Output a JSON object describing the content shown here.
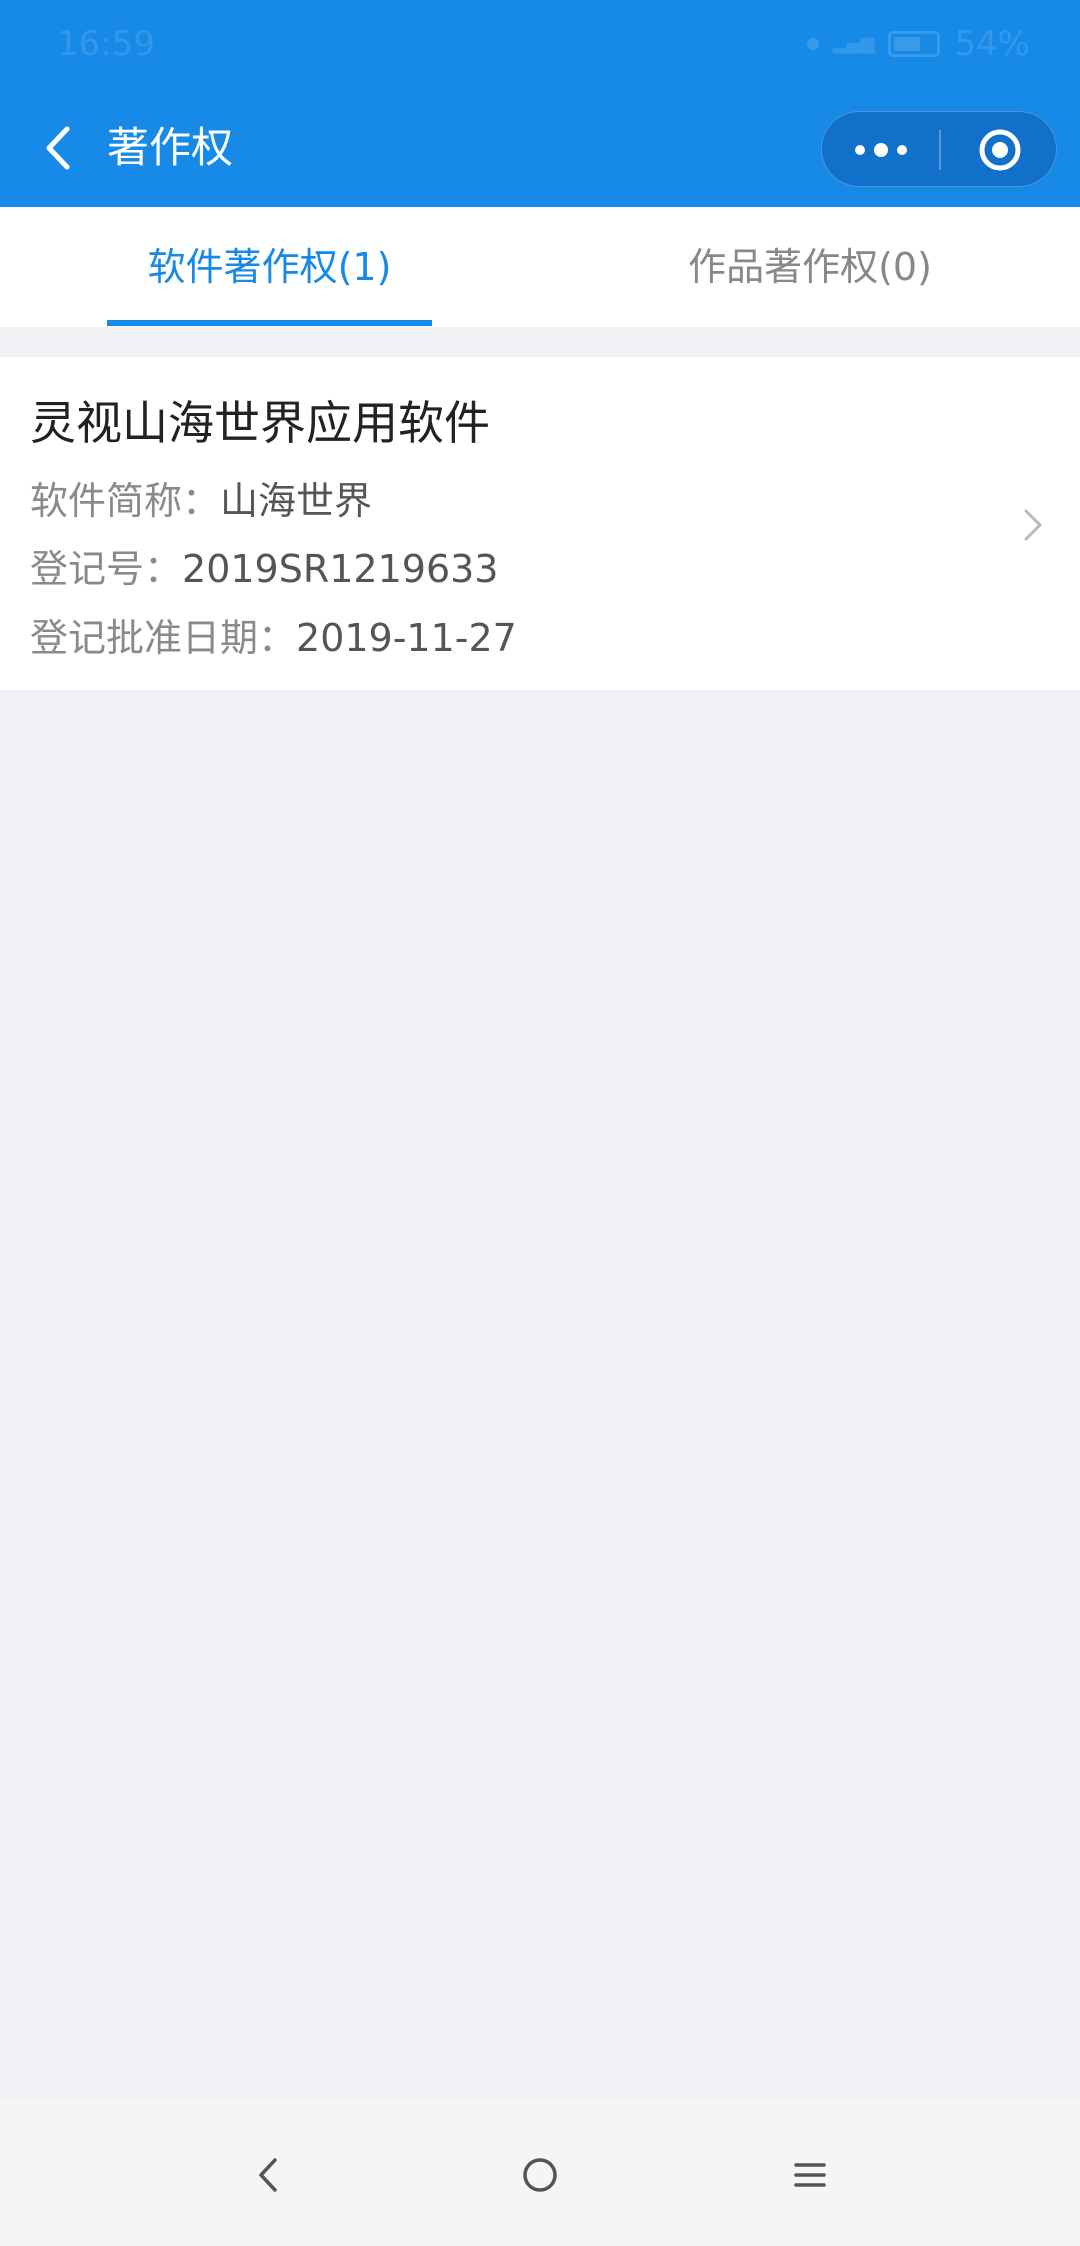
{
  "status_bar": {
    "time": "16:59",
    "battery": "54%"
  },
  "header": {
    "title": "著作权"
  },
  "tabs": [
    {
      "label": "软件著作权(1)",
      "active": true
    },
    {
      "label": "作品著作权(0)",
      "active": false
    }
  ],
  "records": [
    {
      "name": "灵视山海世界应用软件",
      "short_name_label": "软件简称：",
      "short_name": "山海世界",
      "reg_no_label": "登记号：",
      "reg_no": "2019SR1219633",
      "approval_date_label": "登记批准日期：",
      "approval_date": "2019-11-27"
    }
  ],
  "colors": {
    "brand": "#1789e7",
    "background": "#f0f1f4"
  }
}
